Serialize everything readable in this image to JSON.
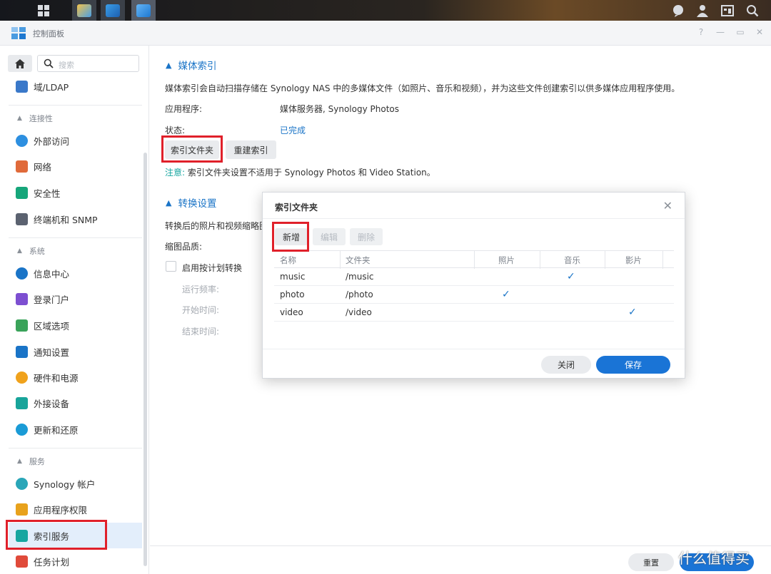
{
  "window": {
    "title": "控制面板",
    "controls": [
      "?",
      "—",
      "▭",
      "✕"
    ]
  },
  "sidebar": {
    "search_placeholder": "搜索",
    "items": [
      {
        "label": "域/LDAP",
        "icon": "domain-icon",
        "color": "#3a78c9"
      },
      {
        "group": "连接性"
      },
      {
        "label": "外部访问",
        "icon": "external-access-icon",
        "color": "#2d8fe0"
      },
      {
        "label": "网络",
        "icon": "network-icon",
        "color": "#e06a3a"
      },
      {
        "label": "安全性",
        "icon": "security-icon",
        "color": "#16a67a"
      },
      {
        "label": "终端机和 SNMP",
        "icon": "terminal-icon",
        "color": "#5b6270"
      },
      {
        "group": "系统"
      },
      {
        "label": "信息中心",
        "icon": "info-center-icon",
        "color": "#1a74c7"
      },
      {
        "label": "登录门户",
        "icon": "login-portal-icon",
        "color": "#7d4fd1"
      },
      {
        "label": "区域选项",
        "icon": "regional-options-icon",
        "color": "#3aa35a"
      },
      {
        "label": "通知设置",
        "icon": "notification-icon",
        "color": "#1a74c7"
      },
      {
        "label": "硬件和电源",
        "icon": "hardware-power-icon",
        "color": "#f0a21c"
      },
      {
        "label": "外接设备",
        "icon": "external-devices-icon",
        "color": "#18a49a"
      },
      {
        "label": "更新和还原",
        "icon": "update-restore-icon",
        "color": "#1a9bd6"
      },
      {
        "group": "服务"
      },
      {
        "label": "Synology 帐户",
        "icon": "synology-account-icon",
        "color": "#2aa6b8"
      },
      {
        "label": "应用程序权限",
        "icon": "app-privileges-icon",
        "color": "#e8a21c"
      },
      {
        "label": "索引服务",
        "icon": "indexing-service-icon",
        "color": "#16a6a0",
        "selected": true
      },
      {
        "label": "任务计划",
        "icon": "task-scheduler-icon",
        "color": "#e04a3a"
      }
    ]
  },
  "main": {
    "media_index": {
      "heading": "媒体索引",
      "description": "媒体索引会自动扫描存储在 Synology NAS 中的多媒体文件（如照片、音乐和视频），并为这些文件创建索引以供多媒体应用程序使用。",
      "app_label": "应用程序:",
      "app_value": "媒体服务器, Synology Photos",
      "status_label": "状态:",
      "status_value": "已完成",
      "index_folder_button": "索引文件夹",
      "reindex_button": "重建索引",
      "note_prefix": "注意:",
      "note_text": " 索引文件夹设置不适用于 Synology Photos 和 Video Station。"
    },
    "conversion": {
      "heading": "转换设置",
      "description": "转换后的照片和视频缩略图",
      "thumb_quality_label": "缩图品质:",
      "schedule_checkbox_label": "启用按计划转换",
      "run_frequency_label": "运行频率:",
      "start_time_label": "开始时间:",
      "end_time_label": "结束时间:"
    }
  },
  "dialog": {
    "title": "索引文件夹",
    "toolbar": {
      "add": "新增",
      "edit": "编辑",
      "delete": "删除"
    },
    "columns": [
      "名称",
      "文件夹",
      "照片",
      "音乐",
      "影片"
    ],
    "rows": [
      {
        "name": "music",
        "folder": "/music",
        "photo": false,
        "music": true,
        "video": false
      },
      {
        "name": "photo",
        "folder": "/photo",
        "photo": true,
        "music": false,
        "video": false
      },
      {
        "name": "video",
        "folder": "/video",
        "photo": false,
        "music": false,
        "video": true
      }
    ],
    "close_button": "关闭",
    "save_button": "保存"
  },
  "footer": {
    "reset_button": "重置",
    "watermark": "什么值得买"
  },
  "colors": {
    "accent": "#1a74d6",
    "highlight": "#e0202a",
    "link": "#1a74c7"
  }
}
